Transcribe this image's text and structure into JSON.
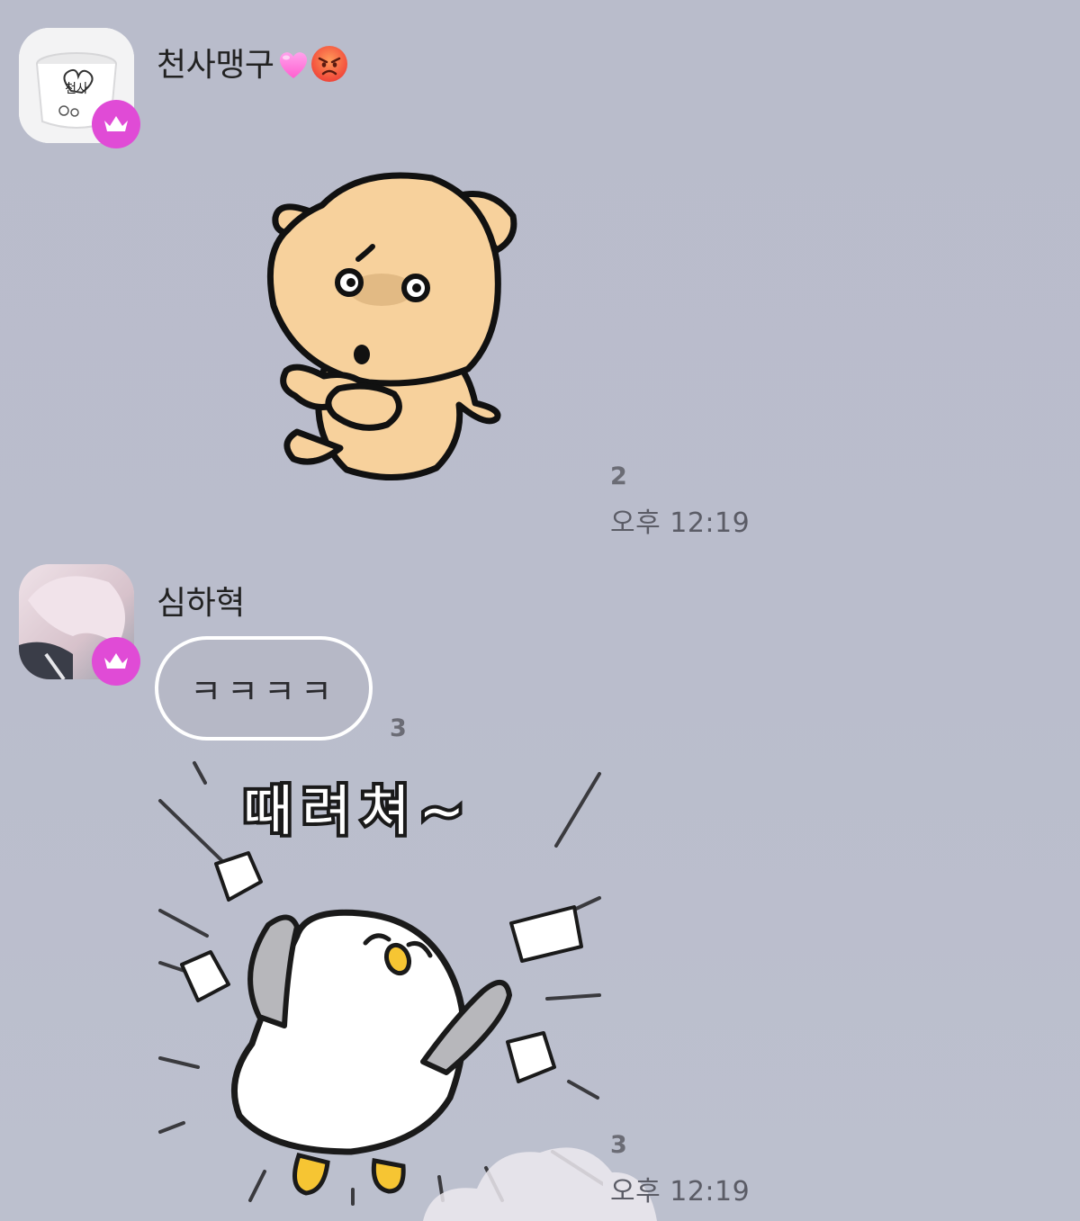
{
  "messages": [
    {
      "sender": "천사맹구",
      "sender_emojis": [
        "pink-heart",
        "angry-face"
      ],
      "type": "sticker",
      "sticker": "bear-sticker",
      "read_count": "2",
      "time": "오후 12:19"
    },
    {
      "sender": "심하혁",
      "text": "ㅋㅋㅋㅋ",
      "read_count_1": "3",
      "sticker": "penguin-sticker",
      "sticker_text": "때려쳐~",
      "read_count_2": "3",
      "time": "오후 12:19"
    }
  ],
  "colors": {
    "background": "#babdcc",
    "crown_badge": "#e04bd6",
    "bubble_border": "#ffffff"
  }
}
